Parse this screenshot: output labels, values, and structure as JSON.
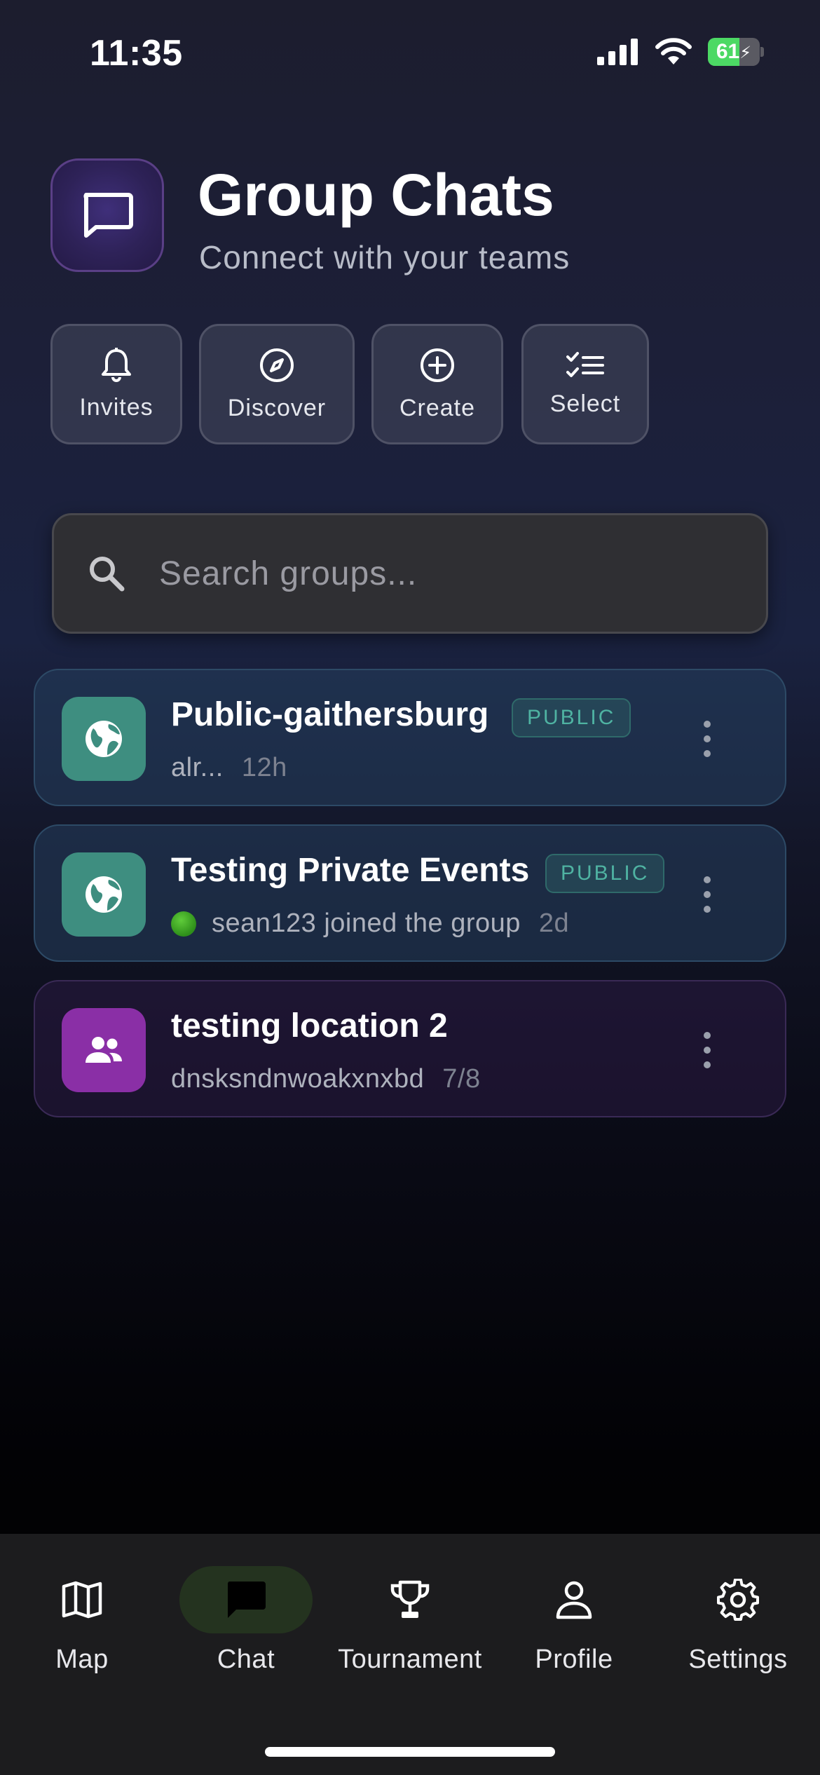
{
  "status_bar": {
    "time": "11:35",
    "battery": "61",
    "battery_level": 0.61
  },
  "header": {
    "title": "Group Chats",
    "subtitle": "Connect with your teams",
    "icon": "chat-bubble-icon"
  },
  "actions": [
    {
      "label": "Invites",
      "icon": "bell-icon"
    },
    {
      "label": "Discover",
      "icon": "compass-icon"
    },
    {
      "label": "Create",
      "icon": "plus-circle-icon"
    },
    {
      "label": "Select",
      "icon": "checklist-icon"
    }
  ],
  "search": {
    "placeholder": "Search groups...",
    "value": ""
  },
  "groups": [
    {
      "name": "Public-gaithersburg",
      "badge": "PUBLIC",
      "preview": "alr...",
      "time": "12h",
      "type": "public",
      "icon": "globe-icon"
    },
    {
      "name": "Testing Private Events",
      "badge": "PUBLIC",
      "preview": "sean123 joined the group",
      "time": "2d",
      "type": "public",
      "icon": "globe-icon"
    },
    {
      "name": "testing location 2",
      "badge": "",
      "preview": "dnsksndnwoakxnxbd",
      "time": "7/8",
      "type": "private",
      "icon": "people-icon"
    }
  ],
  "nav": {
    "items": [
      {
        "label": "Map",
        "icon": "map-icon"
      },
      {
        "label": "Chat",
        "icon": "chat-icon",
        "active": true
      },
      {
        "label": "Tournament",
        "icon": "trophy-icon"
      },
      {
        "label": "Profile",
        "icon": "person-icon"
      },
      {
        "label": "Settings",
        "icon": "gear-icon"
      }
    ]
  },
  "colors": {
    "accent_public": "#3e8e80",
    "accent_private": "#8a2fa6",
    "badge_text": "#4fb3a2",
    "online": "#4caf2a",
    "nav_active": "#24331f"
  }
}
